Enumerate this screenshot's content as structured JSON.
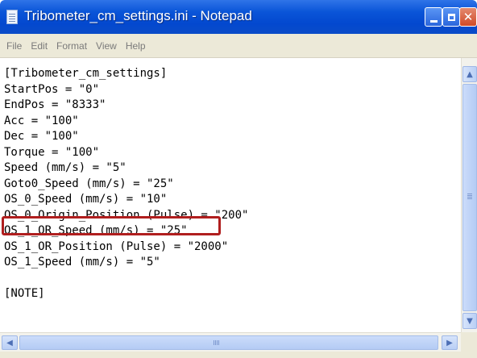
{
  "window": {
    "title": "Tribometer_cm_settings.ini - Notepad",
    "controls": {
      "minimize": "minimize-icon",
      "maximize": "maximize-icon",
      "close": "✕"
    }
  },
  "menu": {
    "items": [
      "File",
      "Edit",
      "Format",
      "View",
      "Help"
    ]
  },
  "editor": {
    "lines": [
      "[Tribometer_cm_settings]",
      "StartPos = \"0\"",
      "EndPos = \"8333\"",
      "Acc = \"100\"",
      "Dec = \"100\"",
      "Torque = \"100\"",
      "Speed (mm/s) = \"5\"",
      "Goto0_Speed (mm/s) = \"25\"",
      "OS_0_Speed (mm/s) = \"10\"",
      "OS_0_Origin_Position (Pulse) = \"200\"",
      "OS_1_OR_Speed (mm/s) = \"25\"",
      "OS_1_OR_Position (Pulse) = \"2000\"",
      "OS_1_Speed (mm/s) = \"5\"",
      "",
      "[NOTE]"
    ],
    "highlighted_line_index": 9,
    "highlight_color": "#b01e1e"
  },
  "scrollbars": {
    "up_arrow": "▲",
    "down_arrow": "▼",
    "left_arrow": "◀",
    "right_arrow": "▶"
  }
}
